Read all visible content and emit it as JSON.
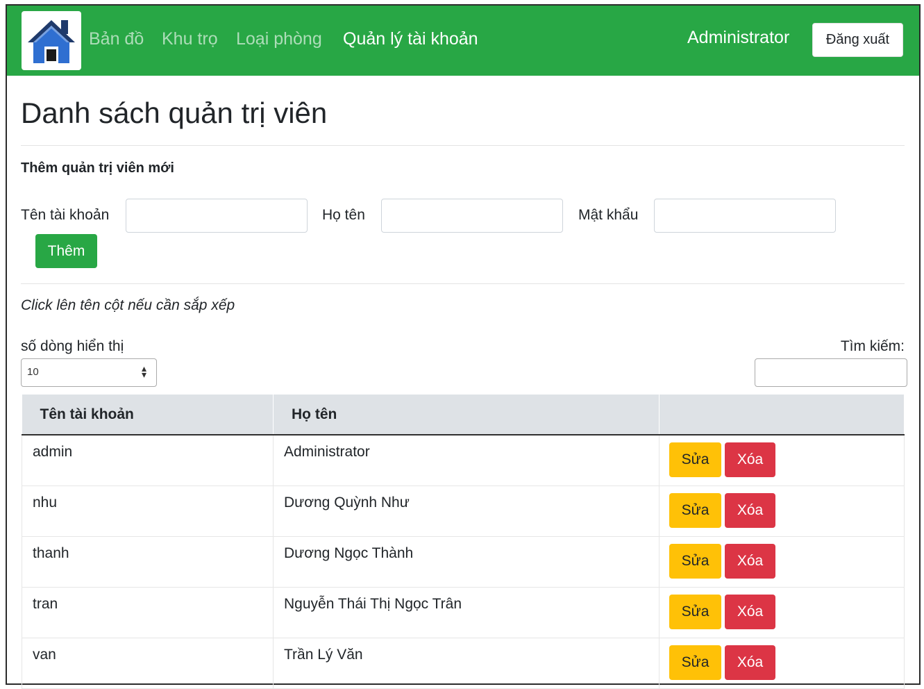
{
  "colors": {
    "navbar_bg": "#28a745",
    "primary_success": "#28a745",
    "warning": "#ffc107",
    "danger": "#dc3545",
    "table_header_bg": "#dee2e6"
  },
  "navbar": {
    "logo_icon": "house-icon",
    "links": [
      {
        "label": "Bản đồ"
      },
      {
        "label": "Khu trọ"
      },
      {
        "label": "Loại phòng"
      },
      {
        "label": "Quản lý tài khoản",
        "active": true
      }
    ],
    "user_name": "Administrator",
    "logout_label": "Đăng xuất"
  },
  "page": {
    "title": "Danh sách quản trị viên"
  },
  "add_form": {
    "title": "Thêm quản trị viên mới",
    "username_label": "Tên tài khoản",
    "username_value": "",
    "fullname_label": "Họ tên",
    "fullname_value": "",
    "password_label": "Mật khẩu",
    "password_value": "",
    "submit_label": "Thêm"
  },
  "list": {
    "hint": "Click lên tên cột nếu cần sắp xếp",
    "rows_label": "số dòng hiển thị",
    "rows_value": "10",
    "search_label": "Tìm kiếm:",
    "search_value": "",
    "columns": [
      "Tên tài khoản",
      "Họ tên",
      ""
    ],
    "edit_label": "Sửa",
    "delete_label": "Xóa",
    "rows": [
      {
        "username": "admin",
        "fullname": "Administrator"
      },
      {
        "username": "nhu",
        "fullname": "Dương Quỳnh Như"
      },
      {
        "username": "thanh",
        "fullname": "Dương Ngọc Thành"
      },
      {
        "username": "tran",
        "fullname": "Nguyễn Thái Thị Ngọc Trân"
      },
      {
        "username": "van",
        "fullname": "Trần Lý Văn"
      }
    ]
  }
}
